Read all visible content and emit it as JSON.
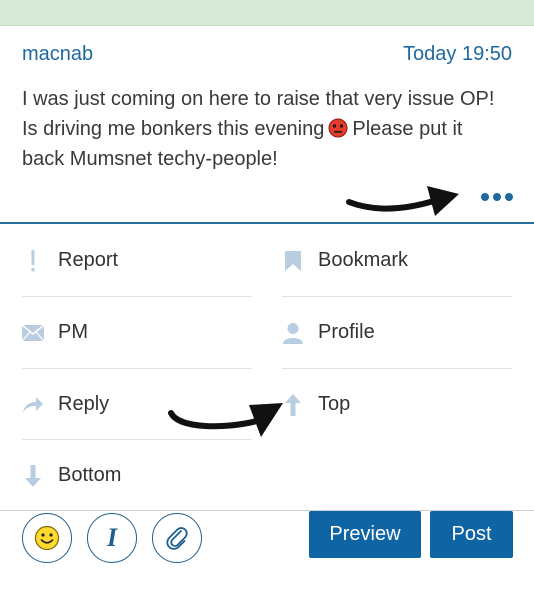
{
  "post": {
    "author": "macnab",
    "time": "Today 19:50",
    "line1": "I was just coming on here to raise that very issue OP!",
    "line2a": "Is driving me bonkers this evening",
    "line2b": "Please put it",
    "line3": "back Mumsnet techy-people!",
    "emoji": "angry-face-icon"
  },
  "menu": {
    "report": "Report",
    "bookmark": "Bookmark",
    "pm": "PM",
    "profile": "Profile",
    "reply": "Reply",
    "top": "Top",
    "bottom": "Bottom"
  },
  "toolbar": {
    "preview_label": "Preview",
    "post_label": "Post",
    "italic_glyph": "I"
  },
  "colors": {
    "accent": "#1e6aa0",
    "button": "#0f65a3",
    "icon": "#b9cde0",
    "top_strip": "#d7ead7"
  }
}
